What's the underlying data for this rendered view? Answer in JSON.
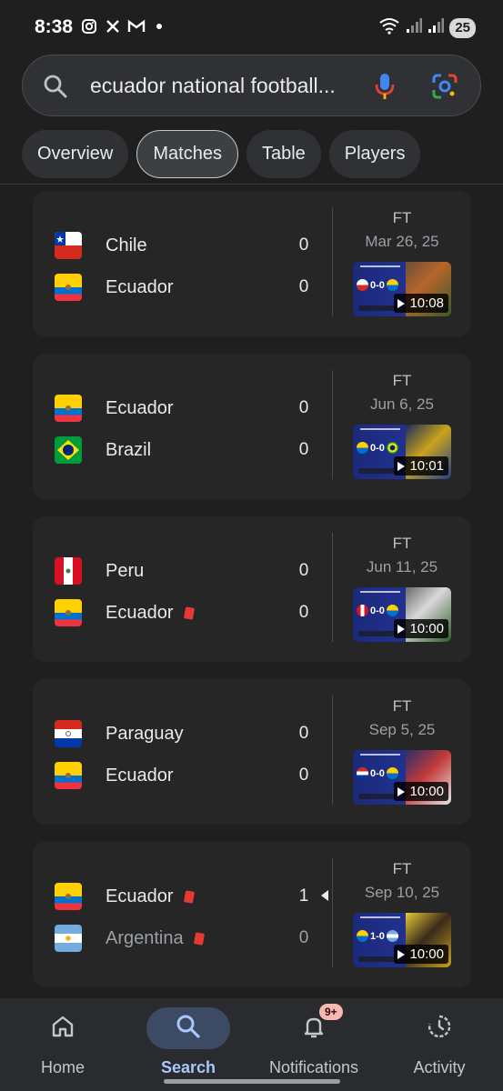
{
  "status_bar": {
    "time": "8:38",
    "battery": "25",
    "left_icons": [
      "instagram-icon",
      "x-icon",
      "gmail-icon",
      "dot-icon"
    ],
    "right_icons": [
      "wifi-icon",
      "signal-icon",
      "signal-icon",
      "battery-icon"
    ]
  },
  "search": {
    "query": "ecuador national football...",
    "icons": [
      "search-icon",
      "mic-icon",
      "lens-icon"
    ]
  },
  "tabs": [
    {
      "label": "Overview",
      "active": false
    },
    {
      "label": "Matches",
      "active": true
    },
    {
      "label": "Table",
      "active": false
    },
    {
      "label": "Players",
      "active": false
    }
  ],
  "matches": [
    {
      "home": {
        "name": "Chile",
        "score": "0",
        "red_card": false,
        "dim": false
      },
      "away": {
        "name": "Ecuador",
        "score": "0",
        "red_card": false,
        "dim": false
      },
      "status": "FT",
      "date": "Mar 26, 25",
      "duration": "10:08",
      "mini_score": "0-0"
    },
    {
      "home": {
        "name": "Ecuador",
        "score": "0",
        "red_card": false,
        "dim": false
      },
      "away": {
        "name": "Brazil",
        "score": "0",
        "red_card": false,
        "dim": false
      },
      "status": "FT",
      "date": "Jun 6, 25",
      "duration": "10:01",
      "mini_score": "0-0"
    },
    {
      "home": {
        "name": "Peru",
        "score": "0",
        "red_card": false,
        "dim": false
      },
      "away": {
        "name": "Ecuador",
        "score": "0",
        "red_card": true,
        "dim": false
      },
      "status": "FT",
      "date": "Jun 11, 25",
      "duration": "10:00",
      "mini_score": "0-0"
    },
    {
      "home": {
        "name": "Paraguay",
        "score": "0",
        "red_card": false,
        "dim": false
      },
      "away": {
        "name": "Ecuador",
        "score": "0",
        "red_card": false,
        "dim": false
      },
      "status": "FT",
      "date": "Sep 5, 25",
      "duration": "10:00",
      "mini_score": "0-0"
    },
    {
      "home": {
        "name": "Ecuador",
        "score": "1",
        "red_card": true,
        "dim": false,
        "winner": true
      },
      "away": {
        "name": "Argentina",
        "score": "0",
        "red_card": true,
        "dim": true
      },
      "status": "FT",
      "date": "Sep 10, 25",
      "duration": "10:00",
      "mini_score": "1-0"
    }
  ],
  "bottom_nav": [
    {
      "label": "Home",
      "icon": "home-icon",
      "active": false
    },
    {
      "label": "Search",
      "icon": "search-icon",
      "active": true
    },
    {
      "label": "Notifications",
      "icon": "bell-icon",
      "active": false,
      "badge": "9+"
    },
    {
      "label": "Activity",
      "icon": "activity-icon",
      "active": false
    }
  ],
  "colors": {
    "background": "#1f1f1f",
    "card": "#262626",
    "accent": "#a8c7fa"
  }
}
